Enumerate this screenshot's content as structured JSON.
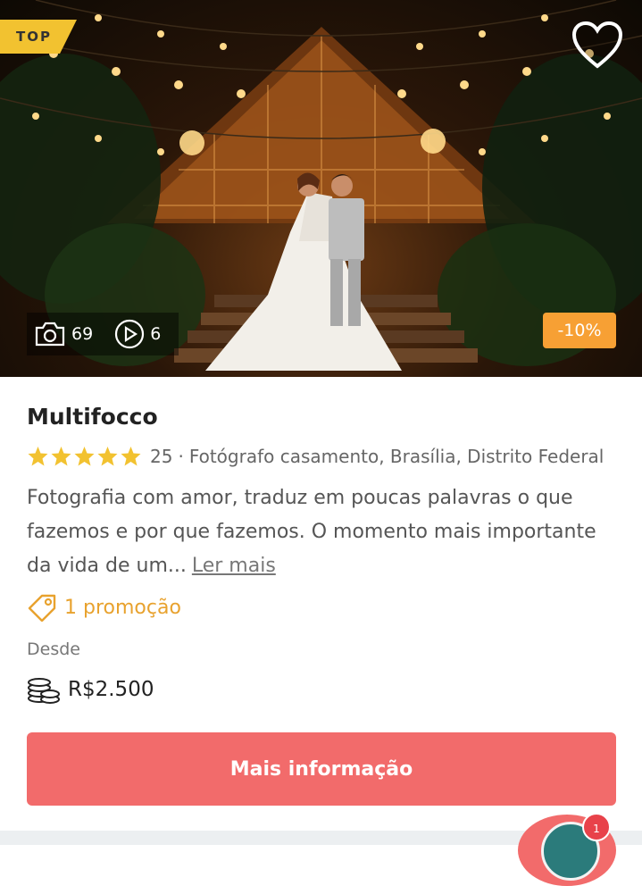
{
  "listing": {
    "badge": "TOP",
    "photo_count": "69",
    "video_count": "6",
    "discount": "-10%",
    "name": "Multifocco",
    "rating_stars": 5,
    "review_count": "25",
    "separator": "·",
    "category_location": "Fotógrafo casamento, Brasília, Distrito Federal",
    "description": "Fotografia com amor, traduz em poucas palavras o que fazemos e por que fazemos. O momento mais importante da vida de um...",
    "read_more_label": "Ler mais",
    "promotion_label": "1 promoção",
    "price_from_label": "Desde",
    "price": "R$2.500",
    "cta_label": "Mais informação"
  },
  "chat": {
    "badge_count": "1"
  },
  "colors": {
    "top_badge": "#f2c230",
    "discount": "#f7a034",
    "star": "#f2c230",
    "promo": "#e8a22e",
    "cta": "#f26b6b"
  },
  "icons": [
    "heart-icon",
    "camera-icon",
    "play-icon",
    "star-icon",
    "tag-icon",
    "coins-icon"
  ]
}
